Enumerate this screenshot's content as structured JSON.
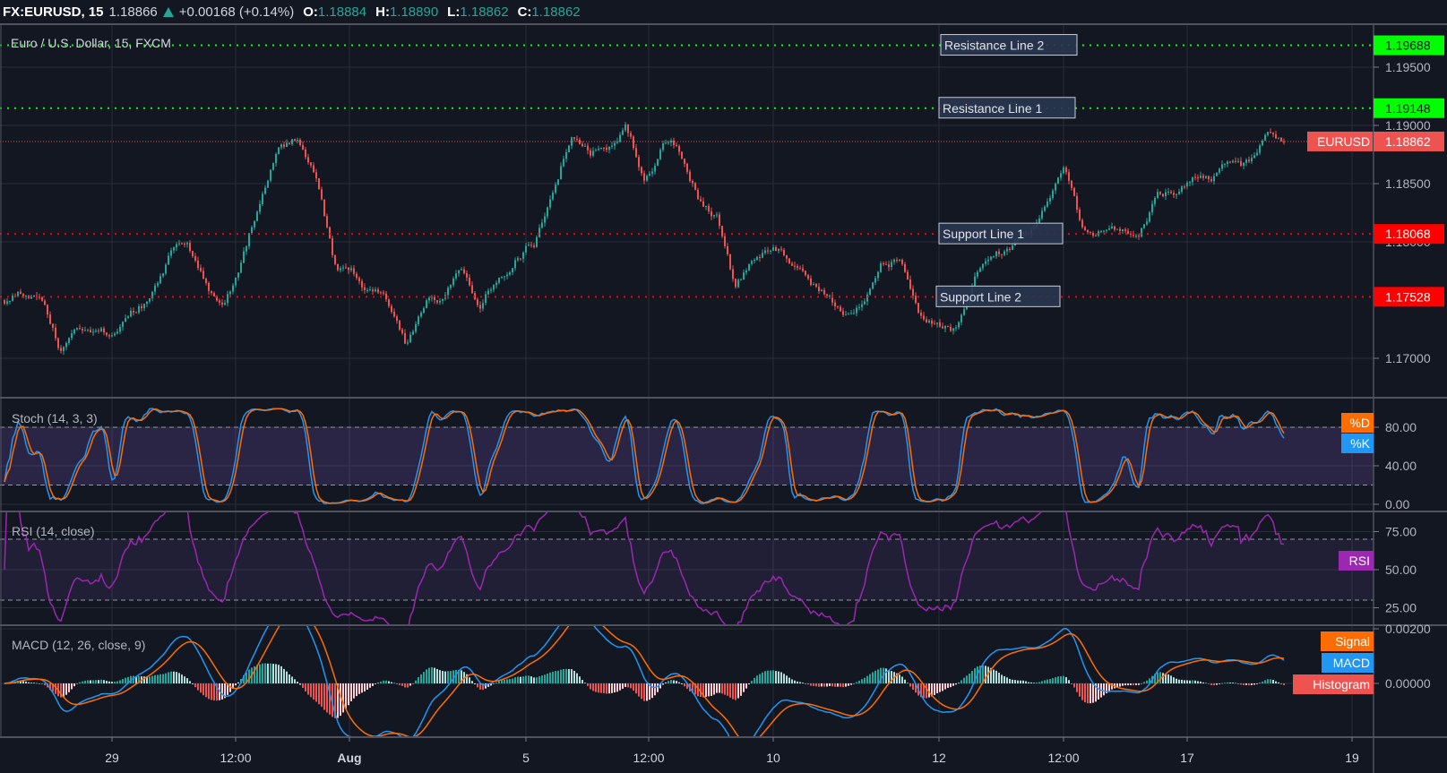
{
  "header": {
    "symbol": "FX:EURUSD, 15",
    "last": "1.18866",
    "direction_icon": "triangle-up",
    "change": "+0.00168 (+0.14%)",
    "o_label": "O:",
    "o": "1.18884",
    "h_label": "H:",
    "h": "1.18890",
    "l_label": "L:",
    "l": "1.18862",
    "c_label": "C:",
    "c": "1.18862"
  },
  "colors": {
    "background": "#131722",
    "grid": "#2a2e39",
    "up": "#26a69a",
    "down": "#ef5350",
    "resistance": "#00ff00",
    "support": "#ff0000",
    "last_price": "#ef5350",
    "stoch_k": "#2196f3",
    "stoch_d": "#ff6d00",
    "rsi": "#9c27b0",
    "macd": "#2196f3",
    "signal": "#ff6d00",
    "histogram": "#ef5350"
  },
  "xticks": [
    "29",
    "12:00",
    "Aug",
    "5",
    "12:00",
    "10",
    "12",
    "12:00",
    "17",
    "19"
  ],
  "chart_data": [
    {
      "type": "candlestick",
      "title": "Euro / U.S. Dollar, 15, FXCM",
      "symbol_label": "EURUSD",
      "last_price": 1.18862,
      "last_price_label": "1.18862",
      "ylim": [
        1.1666,
        1.1987
      ],
      "yticks": [
        "1.19500",
        "1.19000",
        "1.18500",
        "1.18000",
        "1.17000"
      ],
      "grid": true,
      "close_samples": [
        1.1745,
        1.1756,
        1.1748,
        1.1711,
        1.1717,
        1.1723,
        1.172,
        1.1735,
        1.175,
        1.1787,
        1.1793,
        1.1768,
        1.1742,
        1.178,
        1.1836,
        1.188,
        1.189,
        1.1853,
        1.178,
        1.177,
        1.1757,
        1.1747,
        1.171,
        1.1751,
        1.1755,
        1.1777,
        1.175,
        1.1775,
        1.179,
        1.1802,
        1.185,
        1.1897,
        1.1875,
        1.1885,
        1.1905,
        1.1858,
        1.1885,
        1.1877,
        1.184,
        1.1825,
        1.176,
        1.1783,
        1.1795,
        1.1785,
        1.1762,
        1.1755,
        1.1736,
        1.1743,
        1.1783,
        1.1786,
        1.174,
        1.1735,
        1.1728,
        1.1772,
        1.1798,
        1.1795,
        1.181,
        1.1832,
        1.1855,
        1.1801,
        1.1805,
        1.1801,
        1.18,
        1.1833,
        1.184,
        1.186,
        1.185,
        1.1865,
        1.1865,
        1.1888,
        1.18862
      ],
      "horizontal_lines": [
        {
          "label": "Resistance Line 2",
          "value": 1.19688,
          "value_label": "1.19688",
          "kind": "resistance"
        },
        {
          "label": "Resistance Line 1",
          "value": 1.19148,
          "value_label": "1.19148",
          "kind": "resistance"
        },
        {
          "label": "Support Line 1",
          "value": 1.18068,
          "value_label": "1.18068",
          "kind": "support"
        },
        {
          "label": "Support Line 2",
          "value": 1.17528,
          "value_label": "1.17528",
          "kind": "support"
        }
      ]
    },
    {
      "type": "line",
      "title": "Stoch (14, 3, 3)",
      "params": [
        14,
        3,
        3
      ],
      "series": [
        {
          "name": "%D"
        },
        {
          "name": "%K"
        }
      ],
      "bands": [
        20,
        80
      ],
      "ylim": [
        0,
        100
      ],
      "yticks": [
        "80.00",
        "40.00",
        "0.00"
      ]
    },
    {
      "type": "line",
      "title": "RSI (14, close)",
      "params": [
        14
      ],
      "series": [
        {
          "name": "RSI"
        }
      ],
      "bands": [
        30,
        70
      ],
      "ylim": [
        12,
        88
      ],
      "yticks": [
        "75.00",
        "50.00",
        "25.00"
      ]
    },
    {
      "type": "line",
      "title": "MACD (12, 26, close, 9)",
      "params": [
        12,
        26,
        9
      ],
      "series": [
        {
          "name": "Signal"
        },
        {
          "name": "MACD"
        },
        {
          "name": "Histogram"
        }
      ],
      "ylim": [
        -0.00197,
        0.0021
      ],
      "yticks": [
        "0.00200",
        "0.00000"
      ]
    }
  ]
}
